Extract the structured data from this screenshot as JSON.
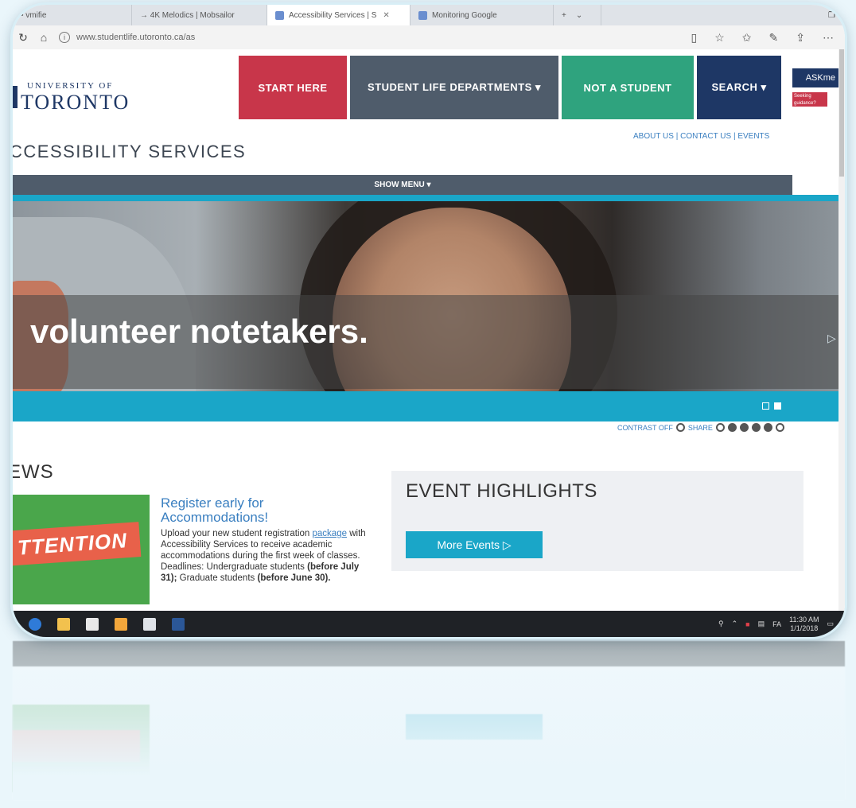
{
  "browser": {
    "tabs": [
      {
        "label": "• vmifie"
      },
      {
        "label": "→ 4K Melodics | Mobsailor"
      },
      {
        "label": "Accessibility Services | S"
      },
      {
        "label": "Monitoring Google"
      }
    ],
    "address": "www.studentlife.utoronto.ca/as"
  },
  "site": {
    "logo_line1": "UNIVERSITY OF",
    "logo_line2": "TORONTO",
    "nav": [
      "START HERE",
      "STUDENT LIFE DEPARTMENTS ▾",
      "NOT A STUDENT",
      "SEARCH ▾"
    ],
    "askme": "ASKme",
    "askme_sub": "Seeking guidance?",
    "toplinks": "ABOUT US | CONTACT US | EVENTS",
    "title": "CCESSIBILITY SERVICES",
    "show_menu": "SHOW MENU ▾",
    "hero_text": "volunteer notetakers.",
    "contrast": "CONTRAST OFF",
    "share": "SHARE"
  },
  "news": {
    "heading": "EWS",
    "image_text": "TTENTION",
    "title": "Register early for Accommodations!",
    "body_pre": "Upload your new student registration",
    "body_link": "package",
    "body_mid": "with Accessibility Services to receive academic accommodations during the first week of classes. Deadlines: Undergraduate students",
    "body_date1": "(before July 31);",
    "body_grad": "Graduate students",
    "body_date2": "(before June 30)."
  },
  "events": {
    "heading": "EVENT HIGHLIGHTS",
    "button": "More Events ▷"
  },
  "taskbar": {
    "time": "11:30 AM",
    "date": "1/1/2018",
    "lang": "FA"
  },
  "colors": {
    "start_here": "#c8364a",
    "departments": "#4f5c6b",
    "not_student": "#2fa37e",
    "search": "#1e3765",
    "accent_blue": "#1aa6c8"
  }
}
